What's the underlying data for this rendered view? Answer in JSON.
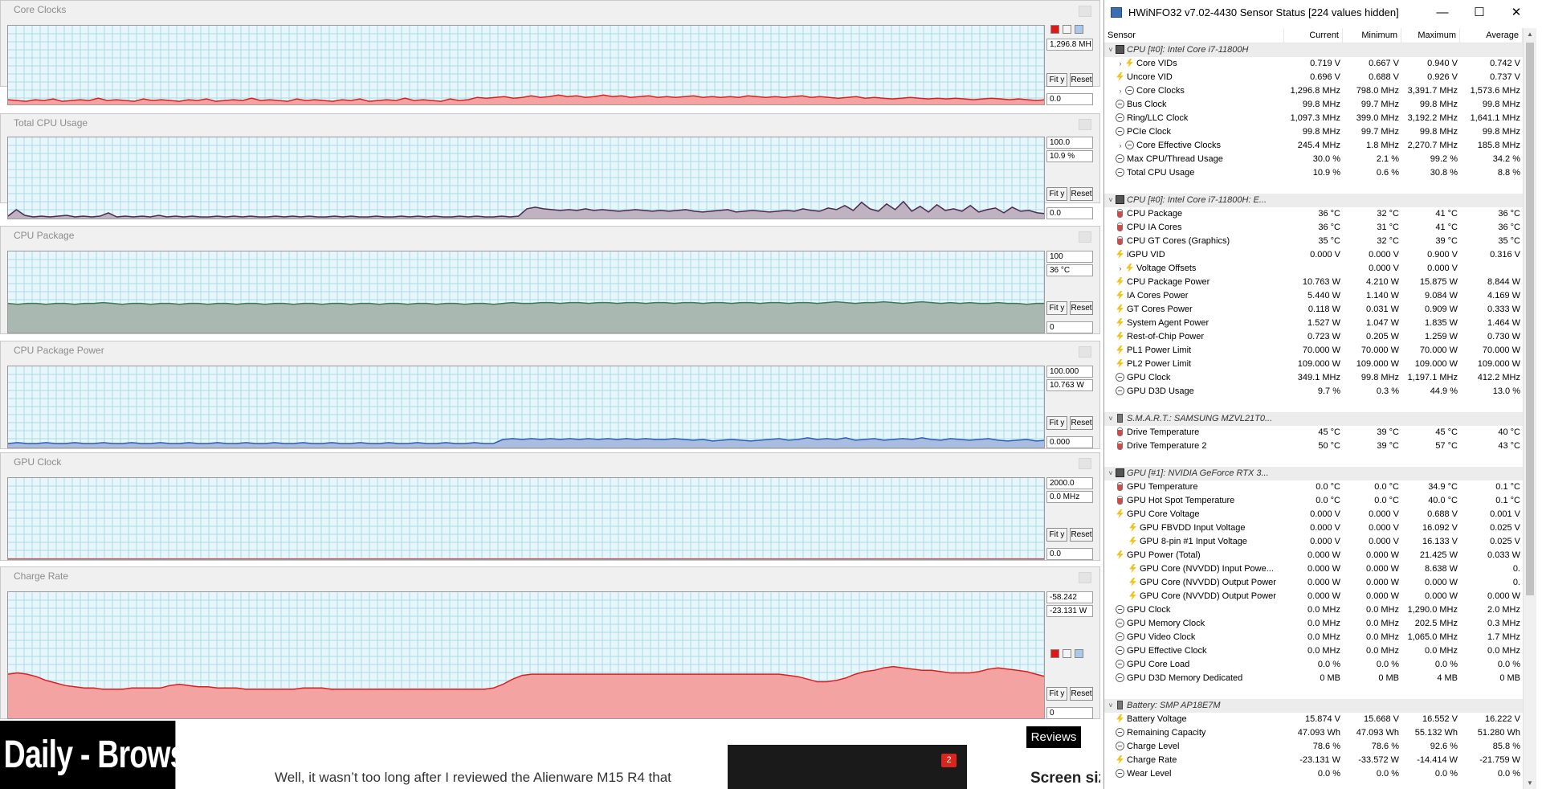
{
  "background_page": {
    "banner": "Daily - Browsing",
    "article_text": "Well, it wasn’t too long after I reviewed the Alienware M15 R4 that",
    "reviews_label": "Reviews",
    "screen_heading": "Screen siz",
    "badge_count": "2"
  },
  "graphs": [
    {
      "title": "Core Clocks",
      "max": "",
      "current": "1,296.8 MH",
      "min": "0.0",
      "fill": "#f4a3a3",
      "line": "#d92020",
      "has_colors": true,
      "series": [
        6,
        5,
        4,
        6,
        5,
        7,
        4,
        5,
        6,
        5,
        8,
        5,
        6,
        5,
        4,
        7,
        5,
        6,
        5,
        4,
        6,
        5,
        7,
        4,
        5,
        6,
        5,
        8,
        5,
        6,
        5,
        4,
        7,
        5,
        6,
        5,
        4,
        6,
        5,
        7,
        4,
        5,
        6,
        5,
        8,
        5,
        6,
        5,
        4,
        7,
        5,
        6,
        9,
        8,
        9,
        10,
        8,
        9,
        11,
        9,
        10,
        12,
        10,
        11,
        9,
        10,
        12,
        10,
        11,
        9,
        10,
        11,
        9,
        10,
        9,
        10,
        11,
        9,
        10,
        9,
        10,
        9,
        11,
        10,
        9,
        10,
        9,
        10,
        11,
        9,
        10,
        9,
        8,
        9,
        10,
        8,
        9,
        8,
        7,
        8,
        9,
        8,
        7,
        8,
        7,
        8,
        7,
        6,
        7,
        8,
        7,
        6,
        7,
        6,
        5,
        6
      ]
    },
    {
      "title": "Total CPU Usage",
      "max": "100.0",
      "current": "10.9 %",
      "min": "0.0",
      "fill": "#bfb3c2",
      "line": "#4a2a52",
      "has_colors": false,
      "series": [
        3,
        11,
        4,
        2,
        3,
        2,
        3,
        4,
        2,
        3,
        2,
        3,
        7,
        2,
        3,
        2,
        3,
        2,
        4,
        2,
        3,
        2,
        3,
        2,
        2,
        3,
        2,
        3,
        2,
        3,
        2,
        2,
        3,
        2,
        3,
        2,
        3,
        2,
        2,
        3,
        2,
        3,
        2,
        2,
        3,
        2,
        2,
        3,
        2,
        3,
        2,
        3,
        2,
        2,
        3,
        2,
        3,
        2,
        2,
        3,
        2,
        3,
        12,
        14,
        12,
        11,
        10,
        11,
        10,
        12,
        10,
        11,
        10,
        9,
        10,
        11,
        10,
        9,
        10,
        9,
        10,
        11,
        9,
        8,
        9,
        10,
        11,
        8,
        9,
        10,
        9,
        8,
        9,
        10,
        9,
        12,
        10,
        9,
        13,
        11,
        16,
        10,
        20,
        12,
        9,
        18,
        11,
        21,
        9,
        15,
        8,
        17,
        10,
        12,
        9,
        16,
        8,
        11,
        13,
        7,
        14,
        9,
        10,
        7,
        6
      ]
    },
    {
      "title": "CPU Package",
      "max": "100",
      "current": "36 °C",
      "min": "0",
      "fill": "#a9b8b0",
      "line": "#3c7a56",
      "has_colors": false,
      "series": [
        36,
        35,
        36,
        36,
        35,
        36,
        36,
        35,
        36,
        36,
        37,
        36,
        35,
        36,
        36,
        35,
        36,
        36,
        35,
        36,
        36,
        35,
        36,
        36,
        35,
        36,
        36,
        35,
        36,
        36,
        35,
        36,
        36,
        35,
        36,
        36,
        35,
        36,
        36,
        35,
        36,
        36,
        35,
        36,
        36,
        35,
        36,
        36,
        35,
        36,
        36,
        35,
        36,
        37,
        36,
        36,
        37,
        37,
        36,
        37,
        37,
        36,
        37,
        37,
        36,
        37,
        37,
        36,
        37,
        37,
        36,
        37,
        37,
        36,
        37,
        37,
        36,
        37,
        37,
        36,
        37,
        37,
        36,
        37,
        37,
        36,
        37,
        38,
        37,
        36,
        37,
        37,
        38,
        37,
        36,
        37,
        38,
        37,
        36,
        37,
        36,
        37,
        36,
        36,
        37,
        36,
        36,
        35,
        36,
        36
      ]
    },
    {
      "title": "CPU Package Power",
      "max": "100.000",
      "current": "10.763 W",
      "min": "0.000",
      "fill": "#a9bde0",
      "line": "#2b5cb8",
      "has_colors": false,
      "series": [
        5,
        6,
        5,
        5,
        6,
        5,
        5,
        6,
        5,
        5,
        6,
        5,
        5,
        6,
        5,
        5,
        6,
        5,
        5,
        6,
        5,
        5,
        6,
        5,
        5,
        6,
        5,
        5,
        6,
        5,
        5,
        6,
        5,
        5,
        6,
        5,
        5,
        6,
        5,
        5,
        6,
        5,
        5,
        6,
        5,
        5,
        6,
        5,
        5,
        6,
        5,
        5,
        10,
        11,
        10,
        11,
        10,
        11,
        10,
        11,
        10,
        11,
        10,
        11,
        10,
        11,
        10,
        11,
        10,
        10,
        11,
        10,
        9,
        10,
        8,
        9,
        10,
        9,
        8,
        9,
        10,
        11,
        9,
        10,
        12,
        10,
        11,
        10,
        12,
        9,
        10,
        11,
        9,
        10,
        11,
        10,
        12,
        10,
        9,
        11,
        10,
        9,
        10,
        11,
        9,
        8,
        9,
        10,
        8,
        9
      ]
    },
    {
      "title": "GPU Clock",
      "max": "2000.0",
      "current": "0.0 MHz",
      "min": "0.0",
      "fill": "#f4a3a3",
      "line": "#d92020",
      "has_colors": false,
      "series": [
        0,
        0,
        0,
        0,
        0,
        0,
        0,
        0,
        0,
        0,
        0,
        0,
        0,
        0,
        0,
        0,
        0,
        0,
        0,
        0
      ]
    },
    {
      "title": "Charge Rate",
      "max": "-58.242",
      "current": "-23.131 W",
      "min": "0",
      "fill": "#f4a3a3",
      "line": "#d92020",
      "has_colors": true,
      "series": [
        35,
        36,
        35,
        33,
        30,
        28,
        26,
        25,
        24,
        24,
        23,
        23,
        23,
        24,
        24,
        24,
        24,
        26,
        27,
        26,
        25,
        25,
        24,
        24,
        24,
        23,
        23,
        23,
        23,
        23,
        23,
        24,
        24,
        24,
        23,
        23,
        23,
        23,
        23,
        23,
        23,
        23,
        23,
        23,
        23,
        23,
        23,
        23,
        23,
        23,
        23,
        24,
        27,
        31,
        34,
        35,
        35,
        35,
        35,
        35,
        35,
        35,
        35,
        35,
        35,
        35,
        35,
        35,
        35,
        35,
        35,
        35,
        35,
        35,
        35,
        35,
        35,
        35,
        35,
        35,
        35,
        35,
        34,
        33,
        31,
        29,
        29,
        30,
        32,
        35,
        37,
        38,
        40,
        41,
        40,
        39,
        38,
        38,
        37,
        36,
        36,
        36,
        37,
        39,
        40,
        39,
        38,
        37,
        35,
        33
      ]
    }
  ],
  "hwinfo": {
    "title": "HWiNFO32 v7.02-4430 Sensor Status [224 values hidden]",
    "window_controls": {
      "minimize": "—",
      "maximize": "☐",
      "close": "✕"
    },
    "columns": [
      "Sensor",
      "Current",
      "Minimum",
      "Maximum",
      "Average"
    ],
    "rows": [
      {
        "type": "group",
        "name": "CPU [#0]: Intel Core i7-11800H",
        "icon": "chip"
      },
      {
        "name": "Core VIDs",
        "icon": "volt",
        "expand": ">",
        "indent": 1,
        "cur": "0.719 V",
        "min": "0.667 V",
        "max": "0.940 V",
        "avg": "0.742 V"
      },
      {
        "name": "Uncore VID",
        "icon": "volt",
        "cur": "0.696 V",
        "min": "0.688 V",
        "max": "0.926 V",
        "avg": "0.737 V"
      },
      {
        "name": "Core Clocks",
        "icon": "clock",
        "expand": ">",
        "indent": 1,
        "cur": "1,296.8 MHz",
        "min": "798.0 MHz",
        "max": "3,391.7 MHz",
        "avg": "1,573.6 MHz"
      },
      {
        "name": "Bus Clock",
        "icon": "clock",
        "cur": "99.8 MHz",
        "min": "99.7 MHz",
        "max": "99.8 MHz",
        "avg": "99.8 MHz"
      },
      {
        "name": "Ring/LLC Clock",
        "icon": "clock",
        "cur": "1,097.3 MHz",
        "min": "399.0 MHz",
        "max": "3,192.2 MHz",
        "avg": "1,641.1 MHz"
      },
      {
        "name": "PCIe Clock",
        "icon": "clock",
        "cur": "99.8 MHz",
        "min": "99.7 MHz",
        "max": "99.8 MHz",
        "avg": "99.8 MHz"
      },
      {
        "name": "Core Effective Clocks",
        "icon": "clock",
        "expand": ">",
        "indent": 1,
        "cur": "245.4 MHz",
        "min": "1.8 MHz",
        "max": "2,270.7 MHz",
        "avg": "185.8 MHz"
      },
      {
        "name": "Max CPU/Thread Usage",
        "icon": "clock",
        "cur": "30.0 %",
        "min": "2.1 %",
        "max": "99.2 %",
        "avg": "34.2 %"
      },
      {
        "name": "Total CPU Usage",
        "icon": "clock",
        "cur": "10.9 %",
        "min": "0.6 %",
        "max": "30.8 %",
        "avg": "8.8 %"
      },
      {
        "type": "blank"
      },
      {
        "type": "group",
        "name": "CPU [#0]: Intel Core i7-11800H: E...",
        "icon": "chip"
      },
      {
        "name": "CPU Package",
        "icon": "temp",
        "cur": "36 °C",
        "min": "32 °C",
        "max": "41 °C",
        "avg": "36 °C"
      },
      {
        "name": "CPU IA Cores",
        "icon": "temp",
        "cur": "36 °C",
        "min": "31 °C",
        "max": "41 °C",
        "avg": "36 °C"
      },
      {
        "name": "CPU GT Cores (Graphics)",
        "icon": "temp",
        "cur": "35 °C",
        "min": "32 °C",
        "max": "39 °C",
        "avg": "35 °C"
      },
      {
        "name": "iGPU VID",
        "icon": "volt",
        "cur": "0.000 V",
        "min": "0.000 V",
        "max": "0.900 V",
        "avg": "0.316 V"
      },
      {
        "name": "Voltage Offsets",
        "icon": "volt",
        "expand": ">",
        "indent": 1,
        "cur": "",
        "min": "0.000 V",
        "max": "0.000 V",
        "avg": ""
      },
      {
        "name": "CPU Package Power",
        "icon": "volt",
        "cur": "10.763 W",
        "min": "4.210 W",
        "max": "15.875 W",
        "avg": "8.844 W"
      },
      {
        "name": "IA Cores Power",
        "icon": "volt",
        "cur": "5.440 W",
        "min": "1.140 W",
        "max": "9.084 W",
        "avg": "4.169 W"
      },
      {
        "name": "GT Cores Power",
        "icon": "volt",
        "cur": "0.118 W",
        "min": "0.031 W",
        "max": "0.909 W",
        "avg": "0.333 W"
      },
      {
        "name": "System Agent Power",
        "icon": "volt",
        "cur": "1.527 W",
        "min": "1.047 W",
        "max": "1.835 W",
        "avg": "1.464 W"
      },
      {
        "name": "Rest-of-Chip Power",
        "icon": "volt",
        "cur": "0.723 W",
        "min": "0.205 W",
        "max": "1.259 W",
        "avg": "0.730 W"
      },
      {
        "name": "PL1 Power Limit",
        "icon": "volt",
        "cur": "70.000 W",
        "min": "70.000 W",
        "max": "70.000 W",
        "avg": "70.000 W"
      },
      {
        "name": "PL2 Power Limit",
        "icon": "volt",
        "cur": "109.000 W",
        "min": "109.000 W",
        "max": "109.000 W",
        "avg": "109.000 W"
      },
      {
        "name": "GPU Clock",
        "icon": "clock",
        "cur": "349.1 MHz",
        "min": "99.8 MHz",
        "max": "1,197.1 MHz",
        "avg": "412.2 MHz"
      },
      {
        "name": "GPU D3D Usage",
        "icon": "clock",
        "cur": "9.7 %",
        "min": "0.3 %",
        "max": "44.9 %",
        "avg": "13.0 %"
      },
      {
        "type": "blank"
      },
      {
        "type": "group",
        "name": "S.M.A.R.T.: SAMSUNG MZVL21T0...",
        "icon": "batt"
      },
      {
        "name": "Drive Temperature",
        "icon": "temp",
        "cur": "45 °C",
        "min": "39 °C",
        "max": "45 °C",
        "avg": "40 °C"
      },
      {
        "name": "Drive Temperature 2",
        "icon": "temp",
        "cur": "50 °C",
        "min": "39 °C",
        "max": "57 °C",
        "avg": "43 °C"
      },
      {
        "type": "blank"
      },
      {
        "type": "group",
        "name": "GPU [#1]: NVIDIA GeForce RTX 3...",
        "icon": "chip"
      },
      {
        "name": "GPU Temperature",
        "icon": "temp",
        "cur": "0.0 °C",
        "min": "0.0 °C",
        "max": "34.9 °C",
        "avg": "0.1 °C"
      },
      {
        "name": "GPU Hot Spot Temperature",
        "icon": "temp",
        "cur": "0.0 °C",
        "min": "0.0 °C",
        "max": "40.0 °C",
        "avg": "0.1 °C"
      },
      {
        "name": "GPU Core Voltage",
        "icon": "volt",
        "cur": "0.000 V",
        "min": "0.000 V",
        "max": "0.688 V",
        "avg": "0.001 V"
      },
      {
        "name": "GPU FBVDD Input Voltage",
        "icon": "volt",
        "indent": 2,
        "cur": "0.000 V",
        "min": "0.000 V",
        "max": "16.092 V",
        "avg": "0.025 V"
      },
      {
        "name": "GPU 8-pin #1 Input Voltage",
        "icon": "volt",
        "indent": 2,
        "cur": "0.000 V",
        "min": "0.000 V",
        "max": "16.133 V",
        "avg": "0.025 V"
      },
      {
        "name": "GPU Power (Total)",
        "icon": "volt",
        "cur": "0.000 W",
        "min": "0.000 W",
        "max": "21.425 W",
        "avg": "0.033 W"
      },
      {
        "name": "GPU Core (NVVDD) Input Powe...",
        "icon": "volt",
        "indent": 2,
        "cur": "0.000 W",
        "min": "0.000 W",
        "max": "8.638 W",
        "avg": "0."
      },
      {
        "name": "GPU Core (NVVDD) Output Power",
        "icon": "volt",
        "indent": 2,
        "cur": "0.000 W",
        "min": "0.000 W",
        "max": "0.000 W",
        "avg": "0."
      },
      {
        "name": "GPU Core (NVVDD) Output Power",
        "icon": "volt",
        "indent": 2,
        "cur": "0.000 W",
        "min": "0.000 W",
        "max": "0.000 W",
        "avg": "0.000 W"
      },
      {
        "name": "GPU Clock",
        "icon": "clock",
        "cur": "0.0 MHz",
        "min": "0.0 MHz",
        "max": "1,290.0 MHz",
        "avg": "2.0 MHz"
      },
      {
        "name": "GPU Memory Clock",
        "icon": "clock",
        "cur": "0.0 MHz",
        "min": "0.0 MHz",
        "max": "202.5 MHz",
        "avg": "0.3 MHz"
      },
      {
        "name": "GPU Video Clock",
        "icon": "clock",
        "cur": "0.0 MHz",
        "min": "0.0 MHz",
        "max": "1,065.0 MHz",
        "avg": "1.7 MHz"
      },
      {
        "name": "GPU Effective Clock",
        "icon": "clock",
        "cur": "0.0 MHz",
        "min": "0.0 MHz",
        "max": "0.0 MHz",
        "avg": "0.0 MHz"
      },
      {
        "name": "GPU Core Load",
        "icon": "clock",
        "cur": "0.0 %",
        "min": "0.0 %",
        "max": "0.0 %",
        "avg": "0.0 %"
      },
      {
        "name": "GPU D3D Memory Dedicated",
        "icon": "clock",
        "cur": "0 MB",
        "min": "0 MB",
        "max": "4 MB",
        "avg": "0 MB"
      },
      {
        "type": "blank"
      },
      {
        "type": "group",
        "name": "Battery: SMP  AP18E7M",
        "icon": "batt"
      },
      {
        "name": "Battery Voltage",
        "icon": "volt",
        "cur": "15.874 V",
        "min": "15.668 V",
        "max": "16.552 V",
        "avg": "16.222 V"
      },
      {
        "name": "Remaining Capacity",
        "icon": "clock",
        "cur": "47.093 Wh",
        "min": "47.093 Wh",
        "max": "55.132 Wh",
        "avg": "51.280 Wh"
      },
      {
        "name": "Charge Level",
        "icon": "clock",
        "cur": "78.6 %",
        "min": "78.6 %",
        "max": "92.6 %",
        "avg": "85.8 %"
      },
      {
        "name": "Charge Rate",
        "icon": "volt",
        "cur": "-23.131 W",
        "min": "-33.572 W",
        "max": "-14.414 W",
        "avg": "-21.759 W"
      },
      {
        "name": "Wear Level",
        "icon": "clock",
        "cur": "0.0 %",
        "min": "0.0 %",
        "max": "0.0 %",
        "avg": "0.0 %"
      }
    ]
  }
}
